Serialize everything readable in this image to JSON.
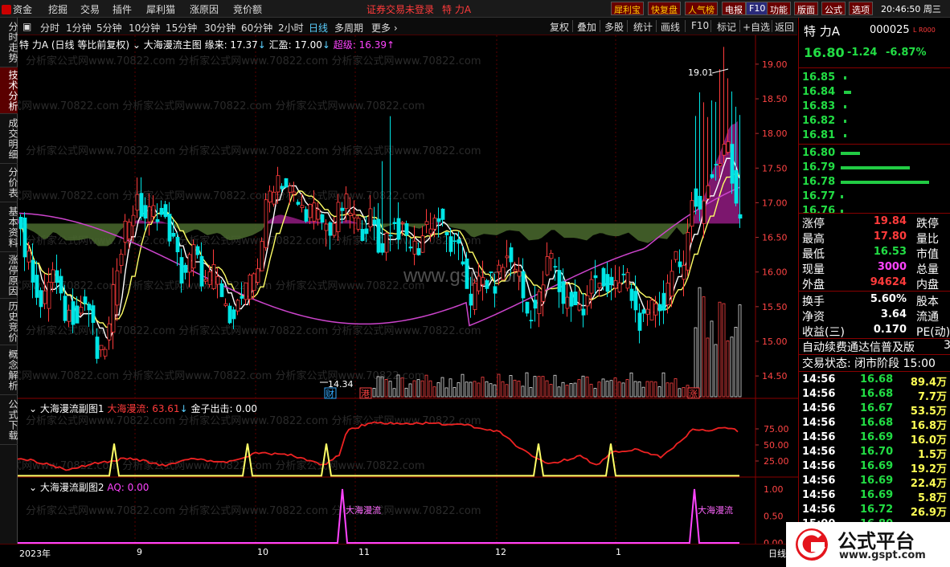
{
  "menu": {
    "items": [
      "资金",
      "挖掘",
      "交易",
      "插件",
      "犀利猫",
      "涨原因",
      "竞价额"
    ],
    "status": "证券交易未登录",
    "stock_name": "特 力A",
    "right_buttons": [
      "犀利宝",
      "快复盘",
      "人气榜",
      "电报",
      "F10",
      "功能",
      "版面",
      "公式",
      "选项"
    ],
    "time": "20:46:50 周三"
  },
  "left_tabs": [
    "分时走势",
    "技术分析",
    "成交明细",
    "分价表",
    "基本资料",
    "涨停原因",
    "历史竞价",
    "概念解析",
    "公式下载"
  ],
  "periods": [
    "分时",
    "1分钟",
    "5分钟",
    "10分钟",
    "15分钟",
    "30分钟",
    "60分钟",
    "2小时",
    "日线",
    "多周期",
    "更多"
  ],
  "active_period": "日线",
  "toolbar": [
    "复权",
    "叠加",
    "多股",
    "统计",
    "画线",
    "F10",
    "标记",
    "+自选",
    "返回"
  ],
  "main_chart": {
    "title": "特 力A (日线 等比前复权)",
    "indicator": "大海漫流主图",
    "l1_label": "缘来: 17.37",
    "l2_label": "汇盈: 17.00",
    "l3_label": "超级: 16.39",
    "high_label": "19.01",
    "low_label": "14.34",
    "markers": [
      "财",
      "港",
      "涨"
    ],
    "y_ticks": [
      "19.00",
      "18.50",
      "18.00",
      "17.50",
      "17.00",
      "16.50",
      "16.00",
      "15.50",
      "15.00",
      "14.50"
    ],
    "watermark": "www.gspt.com",
    "watermark_rows": "分析家公式网www.70822.com"
  },
  "sub1": {
    "title": "大海漫流副图1",
    "v1_label": "大海漫流: 63.61",
    "v2_label": "金子出击: 0.00",
    "y_ticks": [
      "75.00",
      "50.00",
      "25.00"
    ]
  },
  "sub2": {
    "title": "大海漫流副图2",
    "v1_label": "AQ: 0.00",
    "signal_label": "大海漫流",
    "y_ticks": [
      "1.00",
      "0.50",
      "0.00"
    ]
  },
  "x_axis": [
    "2023年",
    "9",
    "10",
    "11",
    "12",
    "1",
    "日线"
  ],
  "quote": {
    "name": "特 力A",
    "code": "000025",
    "tag": "L R000",
    "price": "16.80",
    "change": "-1.24",
    "pct": "-6.87%"
  },
  "asks": [
    {
      "p": "16.85",
      "v": 1
    },
    {
      "p": "16.84",
      "v": 8
    },
    {
      "p": "16.83",
      "v": 1
    },
    {
      "p": "16.82",
      "v": 1
    },
    {
      "p": "16.81",
      "v": 1
    }
  ],
  "bids": [
    {
      "p": "16.80",
      "v": 22
    },
    {
      "p": "16.79",
      "v": 78
    },
    {
      "p": "16.78",
      "v": 100
    },
    {
      "p": "16.77",
      "v": 1
    },
    {
      "p": "16.76",
      "v": 1
    }
  ],
  "stats": [
    [
      "涨停",
      "19.84",
      "跌停"
    ],
    [
      "最高",
      "17.80",
      "量比"
    ],
    [
      "最低",
      "16.53",
      "市值"
    ],
    [
      "现量",
      "3000",
      "总量"
    ],
    [
      "外盘",
      "94624",
      "内盘"
    ]
  ],
  "stats2": [
    [
      "换手",
      "5.60%",
      "股本"
    ],
    [
      "净资",
      "3.64",
      "流通"
    ],
    [
      "收益(三)",
      "0.170",
      "PE(动)"
    ]
  ],
  "notice": "自动续费通达信普及版",
  "notice_num": "3",
  "trade_state": "交易状态: 闭市阶段 15:00",
  "ticks": [
    [
      "14:56",
      "16.68",
      "89.4万"
    ],
    [
      "14:56",
      "16.68",
      "7.7万"
    ],
    [
      "14:56",
      "16.67",
      "53.5万"
    ],
    [
      "14:56",
      "16.68",
      "16.8万"
    ],
    [
      "14:56",
      "16.69",
      "16.0万"
    ],
    [
      "14:56",
      "16.70",
      "1.5万"
    ],
    [
      "14:56",
      "16.69",
      "19.2万"
    ],
    [
      "14:56",
      "16.69",
      "22.4万"
    ],
    [
      "14:56",
      "16.69",
      "5.8万"
    ],
    [
      "14:56",
      "16.72",
      "26.9万"
    ],
    [
      "15:00",
      "16.80",
      ""
    ]
  ],
  "logo": {
    "text": "公式平台",
    "url": "www.gspt.com"
  },
  "colors": {
    "up": "#ff3b3b",
    "down": "#00e5e5",
    "bg": "#000000",
    "border": "#800000"
  }
}
